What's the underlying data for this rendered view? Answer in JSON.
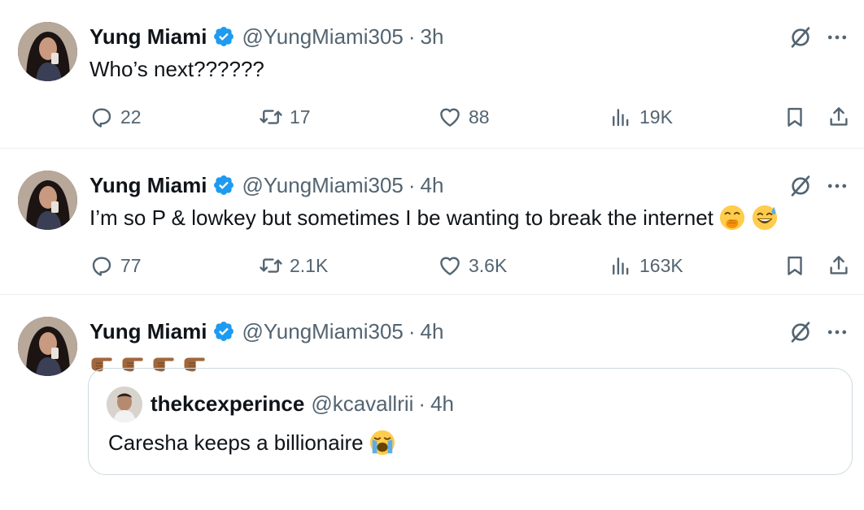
{
  "tweets": [
    {
      "name": "Yung Miami",
      "handle": "@YungMiami305",
      "separator": "·",
      "time": "3h",
      "text": "Who’s next??????",
      "replies": "22",
      "retweets": "17",
      "likes": "88",
      "views": "19K"
    },
    {
      "name": "Yung Miami",
      "handle": "@YungMiami305",
      "separator": "·",
      "time": "4h",
      "text": "I’m so P & lowkey but sometimes I be wanting to break the internet",
      "emojis": [
        "face-with-hand-over-mouth",
        "grinning-face-with-sweat"
      ],
      "replies": "77",
      "retweets": "2.1K",
      "likes": "3.6K",
      "views": "163K"
    },
    {
      "name": "Yung Miami",
      "handle": "@YungMiami305",
      "separator": "·",
      "time": "4h",
      "emojis": [
        "backhand-index-pointing-right",
        "backhand-index-pointing-right",
        "backhand-index-pointing-right",
        "backhand-index-pointing-right"
      ],
      "quote": {
        "name": "thekcexperince",
        "handle": "@kcavallrii",
        "separator": "·",
        "time": "4h",
        "text": "Caresha keeps a billionaire",
        "emoji": "loudly-crying-face"
      }
    }
  ],
  "colors": {
    "text_primary": "#0f1419",
    "text_secondary": "#536471",
    "verified_blue": "#1d9bf0",
    "divider": "#e8ecef",
    "quote_border": "#cfd9de"
  },
  "icons": [
    "verified-badge-icon",
    "grok-icon",
    "more-icon",
    "reply-icon",
    "retweet-icon",
    "like-icon",
    "views-icon",
    "bookmark-icon",
    "share-icon"
  ]
}
